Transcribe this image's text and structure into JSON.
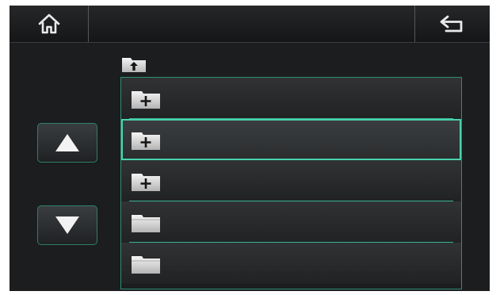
{
  "topbar": {
    "home_icon": "home-icon",
    "back_icon": "back-arrow-icon"
  },
  "navigation": {
    "up_dir_icon": "folder-up-icon",
    "scroll_up_icon": "triangle-up-icon",
    "scroll_down_icon": "triangle-down-icon"
  },
  "folder_list": {
    "items": [
      {
        "icon": "folder-plus-icon",
        "selected": false
      },
      {
        "icon": "folder-plus-icon",
        "selected": true
      },
      {
        "icon": "folder-plus-icon",
        "selected": false
      },
      {
        "icon": "folder-icon",
        "selected": false
      },
      {
        "icon": "folder-icon",
        "selected": false
      }
    ]
  },
  "colors": {
    "background": "#1b1d1e",
    "accent": "#49d2ad",
    "accent_dim": "#2f8f76",
    "icon": "#e6e6e6"
  }
}
